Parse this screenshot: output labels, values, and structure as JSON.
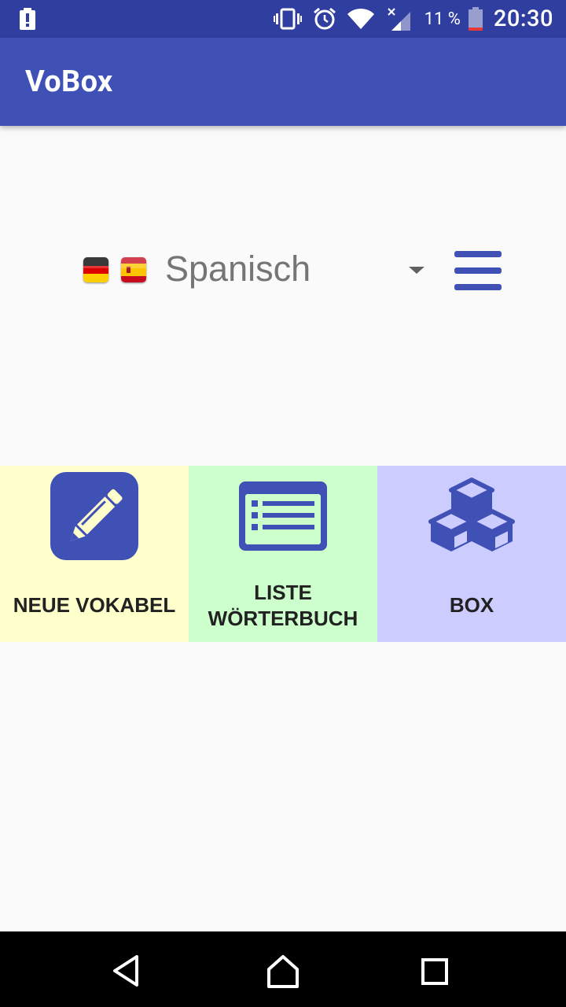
{
  "status_bar": {
    "time": "20:30",
    "battery_percent": "11 %",
    "icons": [
      "alert-icon",
      "vibrate-icon",
      "alarm-icon",
      "wifi-icon",
      "signal-icon",
      "battery-icon"
    ]
  },
  "app_bar": {
    "title": "VoBox"
  },
  "language_selector": {
    "flags": [
      "german-flag-icon",
      "spanish-flag-icon"
    ],
    "selected_language": "Spanisch"
  },
  "tiles": [
    {
      "label": "NEUE VOKABEL",
      "icon": "pencil-edit-icon",
      "color": "#ffffcc"
    },
    {
      "label_line1": "LISTE",
      "label_line2": "WÖRTERBUCH",
      "icon": "list-icon",
      "color": "#ccffcc"
    },
    {
      "label": "BOX",
      "icon": "cubes-icon",
      "color": "#ccccff"
    }
  ],
  "colors": {
    "primary": "#3f51b5",
    "primary_dark": "#303f9f",
    "background": "#fafafa"
  },
  "nav_bar": {
    "buttons": [
      "back-icon",
      "home-icon",
      "recent-apps-icon"
    ]
  }
}
